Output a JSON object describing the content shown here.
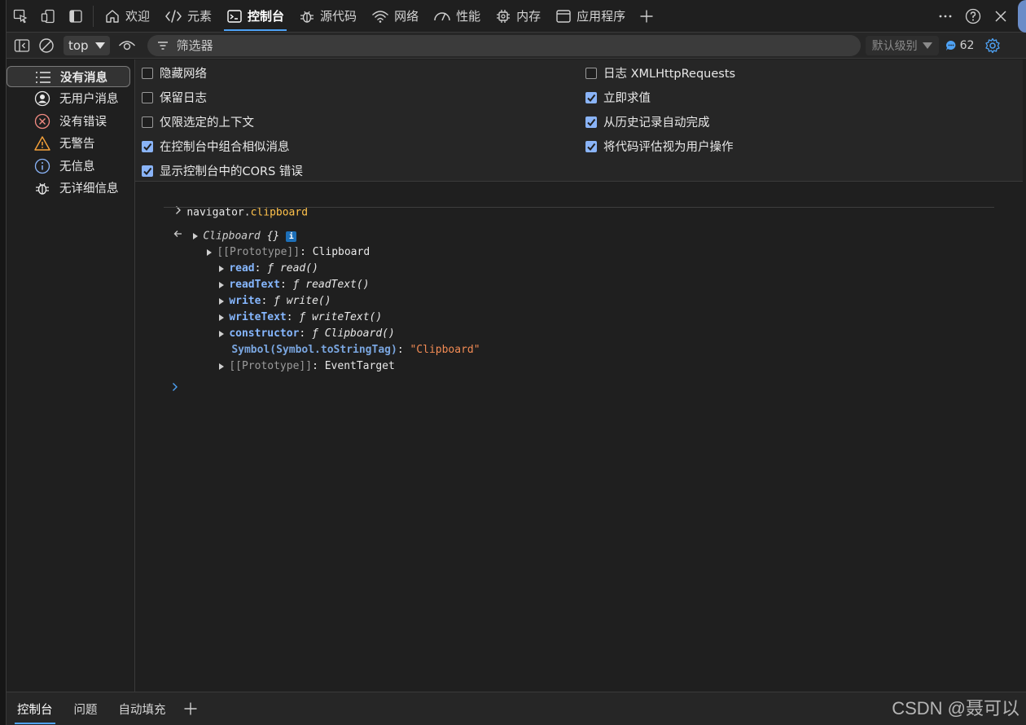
{
  "topbar": {
    "tabs": [
      {
        "label": "欢迎",
        "icon": "home-icon"
      },
      {
        "label": "元素",
        "icon": "code-icon"
      },
      {
        "label": "控制台",
        "icon": "console-icon"
      },
      {
        "label": "源代码",
        "icon": "bug-icon"
      },
      {
        "label": "网络",
        "icon": "wifi-icon"
      },
      {
        "label": "性能",
        "icon": "gauge-icon"
      },
      {
        "label": "内存",
        "icon": "chip-icon"
      },
      {
        "label": "应用程序",
        "icon": "window-icon"
      }
    ],
    "active_tab": "控制台"
  },
  "toolbar": {
    "context": "top",
    "filter_placeholder": "筛选器",
    "level": "默认级别",
    "message_count": "62"
  },
  "sidebar": {
    "items": [
      {
        "label": "没有消息",
        "icon": "list-icon"
      },
      {
        "label": "无用户消息",
        "icon": "user-icon"
      },
      {
        "label": "没有错误",
        "icon": "error-icon"
      },
      {
        "label": "无警告",
        "icon": "warning-icon"
      },
      {
        "label": "无信息",
        "icon": "info-icon"
      },
      {
        "label": "无详细信息",
        "icon": "bug-icon"
      }
    ]
  },
  "settings": {
    "left": [
      {
        "label": "隐藏网络",
        "checked": false
      },
      {
        "label": "保留日志",
        "checked": false
      },
      {
        "label": "仅限选定的上下文",
        "checked": false
      },
      {
        "label": "在控制台中组合相似消息",
        "checked": true
      },
      {
        "label": "显示控制台中的CORS 错误",
        "checked": true
      }
    ],
    "right": [
      {
        "label": "日志 XMLHttpRequests",
        "checked": false
      },
      {
        "label": "立即求值",
        "checked": true
      },
      {
        "label": "从历史记录自动完成",
        "checked": true
      },
      {
        "label": "将代码评估视为用户操作",
        "checked": true
      }
    ]
  },
  "console": {
    "input_object": "navigator",
    "input_dot": ".",
    "input_prop": "clipboard",
    "result_name": "Clipboard",
    "result_braces": " {}",
    "info_badge": "i",
    "proto1_key": "[[Prototype]]",
    "proto1_val": "Clipboard",
    "methods": [
      {
        "key": "read",
        "val": "read()"
      },
      {
        "key": "readText",
        "val": "readText()"
      },
      {
        "key": "write",
        "val": "write()"
      },
      {
        "key": "writeText",
        "val": "writeText()"
      },
      {
        "key": "constructor",
        "val": "Clipboard()"
      }
    ],
    "f_glyph": "ƒ",
    "symbol_key": "Symbol(Symbol.toStringTag)",
    "symbol_val": "\"Clipboard\"",
    "proto2_key": "[[Prototype]]",
    "proto2_val": "EventTarget"
  },
  "drawer": {
    "tabs": [
      "控制台",
      "问题",
      "自动填充"
    ]
  },
  "watermark": "CSDN @聂可以"
}
